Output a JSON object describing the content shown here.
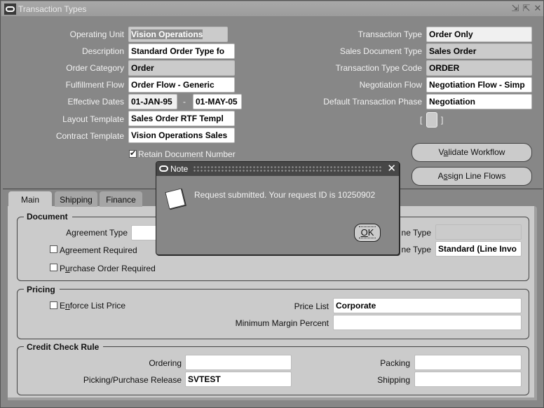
{
  "window": {
    "title": "Transaction Types",
    "controls": [
      "minimize-icon",
      "maximize-icon",
      "close-icon"
    ]
  },
  "header_left": {
    "operating_unit": {
      "label": "Operating Unit",
      "value": "Vision Operations"
    },
    "description": {
      "label": "Description",
      "value": "Standard Order Type fo"
    },
    "order_category": {
      "label": "Order Category",
      "value": "Order"
    },
    "fulfillment_flow": {
      "label": "Fulfillment Flow",
      "value": "Order Flow - Generic"
    },
    "effective_dates": {
      "label": "Effective Dates",
      "from": "01-JAN-95",
      "separator": "-",
      "to": "01-MAY-05"
    },
    "layout_template": {
      "label": "Layout Template",
      "value": "Sales Order RTF Templ"
    },
    "contract_template": {
      "label": "Contract Template",
      "value": "Vision Operations Sales"
    },
    "retain_document_number": {
      "label": "Retain Document Number",
      "checked": true
    }
  },
  "header_right": {
    "transaction_type": {
      "label": "Transaction Type",
      "value": "Order Only"
    },
    "sales_document_type": {
      "label": "Sales Document Type",
      "value": "Sales Order"
    },
    "transaction_type_code": {
      "label": "Transaction Type Code",
      "value": "ORDER"
    },
    "negotiation_flow": {
      "label": "Negotiation Flow",
      "value": "Negotiation Flow - Simp"
    },
    "default_transaction_phase": {
      "label": "Default Transaction Phase",
      "value": "Negotiation"
    },
    "flexfield": {
      "open": "[",
      "close": "]"
    }
  },
  "buttons": {
    "validate_workflow": {
      "pre": "V",
      "mnemonic": "a",
      "post": "lidate Workflow"
    },
    "assign_line_flows": {
      "pre": "A",
      "mnemonic": "s",
      "post": "sign Line  Flows"
    }
  },
  "tabs": [
    {
      "label": "Main",
      "active": true
    },
    {
      "label": "Shipping",
      "active": false
    },
    {
      "label": "Finance",
      "active": false
    }
  ],
  "main_tab": {
    "document": {
      "title": "Document",
      "agreement_type": {
        "label": "Agreement Type",
        "value": ""
      },
      "agreement_required": {
        "label": "Agreement Required",
        "checked": false
      },
      "purchase_order_required": {
        "pre": "P",
        "mnemonic": "u",
        "post": "rchase Order Required",
        "checked": false
      },
      "default_order_line_type": {
        "label_visible": "ne Type",
        "value": ""
      },
      "default_return_line_type": {
        "label_visible": "ne Type",
        "value": "Standard (Line Invo"
      }
    },
    "pricing": {
      "title": "Pricing",
      "enforce_list_price": {
        "pre": "E",
        "mnemonic": "n",
        "post": "force List Price",
        "checked": false
      },
      "price_list": {
        "label": "Price List",
        "value": "Corporate"
      },
      "minimum_margin_percent": {
        "label": "Minimum Margin Percent",
        "value": ""
      }
    },
    "credit_check_rule": {
      "title": "Credit Check Rule",
      "ordering": {
        "label": "Ordering",
        "value": ""
      },
      "picking_purchase_release": {
        "label": "Picking/Purchase Release",
        "value": "SVTEST"
      },
      "packing": {
        "label": "Packing",
        "value": ""
      },
      "shipping": {
        "label": "Shipping",
        "value": ""
      }
    }
  },
  "note_dialog": {
    "title": "Note",
    "message": "Request submitted. Your request ID is 10250902",
    "ok": {
      "mnemonic": "O",
      "post": "K"
    }
  }
}
